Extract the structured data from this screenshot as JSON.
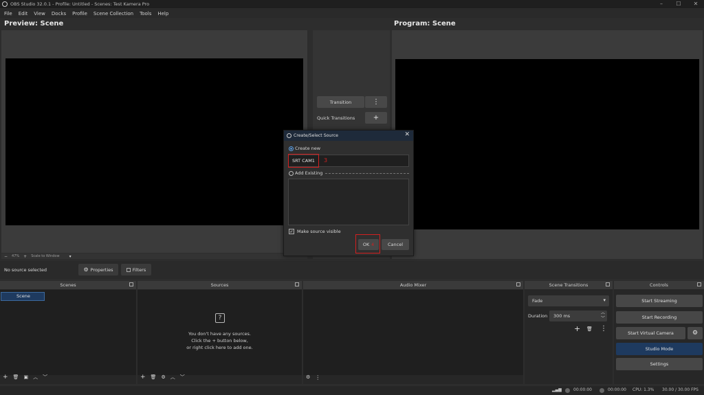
{
  "window": {
    "title": "OBS Studio 32.0.1 - Profile: Untitled - Scenes: Test Kamera Pro",
    "minimize": "–",
    "maximize": "☐",
    "close": "✕"
  },
  "menu": [
    "File",
    "Edit",
    "View",
    "Docks",
    "Profile",
    "Scene Collection",
    "Tools",
    "Help"
  ],
  "preview": {
    "title": "Preview: Scene",
    "zoom_minus": "−",
    "zoom": "47%",
    "zoom_plus": "+",
    "scale_mode": "Scale to Window",
    "dropdown": "▾"
  },
  "program": {
    "title": "Program: Scene"
  },
  "transition_center": {
    "transition_label": "Transition",
    "quick_transitions": "Quick Transitions",
    "menu_icon": "⋮",
    "add_icon": "+"
  },
  "source_bar": {
    "no_source": "No source selected",
    "properties": "Properties",
    "filters": "Filters"
  },
  "docks": {
    "scenes": {
      "title": "Scenes",
      "items": [
        "Scene"
      ],
      "footer": [
        "+",
        "🗑",
        "▣",
        "︿",
        "﹀"
      ]
    },
    "sources": {
      "title": "Sources",
      "empty_icon": "?",
      "empty_line1": "You don't have any sources.",
      "empty_line2": "Click the + button below,",
      "empty_line3": "or right click here to add one.",
      "footer": [
        "+",
        "🗑",
        "⚙",
        "︿",
        "﹀"
      ]
    },
    "audio_mixer": {
      "title": "Audio Mixer",
      "footer": [
        "⚙",
        "⋮"
      ]
    },
    "scene_transitions": {
      "title": "Scene Transitions",
      "selected": "Fade",
      "duration_label": "Duration",
      "duration_value": "300 ms",
      "add": "+",
      "remove": "🗑",
      "more": "⋮"
    },
    "controls": {
      "title": "Controls",
      "start_streaming": "Start Streaming",
      "start_recording": "Start Recording",
      "start_virtual_camera": "Start Virtual Camera",
      "studio_mode": "Studio Mode",
      "settings": "Settings"
    }
  },
  "dialog": {
    "title": "Create/Select Source",
    "create_new": "Create new",
    "name_value": "SRT CAM1",
    "step_3": "3",
    "add_existing": "Add Existing",
    "make_visible": "Make source visible",
    "checkbox_mark": "✓",
    "ok": "OK",
    "step_4": "4",
    "cancel": "Cancel",
    "close": "✕"
  },
  "status_bar": {
    "stream_time": "00:00:00",
    "record_time": "00:00:00",
    "cpu": "CPU: 1.3%",
    "fps": "30.00 / 30.00 FPS"
  },
  "colors": {
    "accent": "#1e3a5f",
    "highlight_red": "#d32020",
    "radio_blue": "#5aa0e6"
  }
}
